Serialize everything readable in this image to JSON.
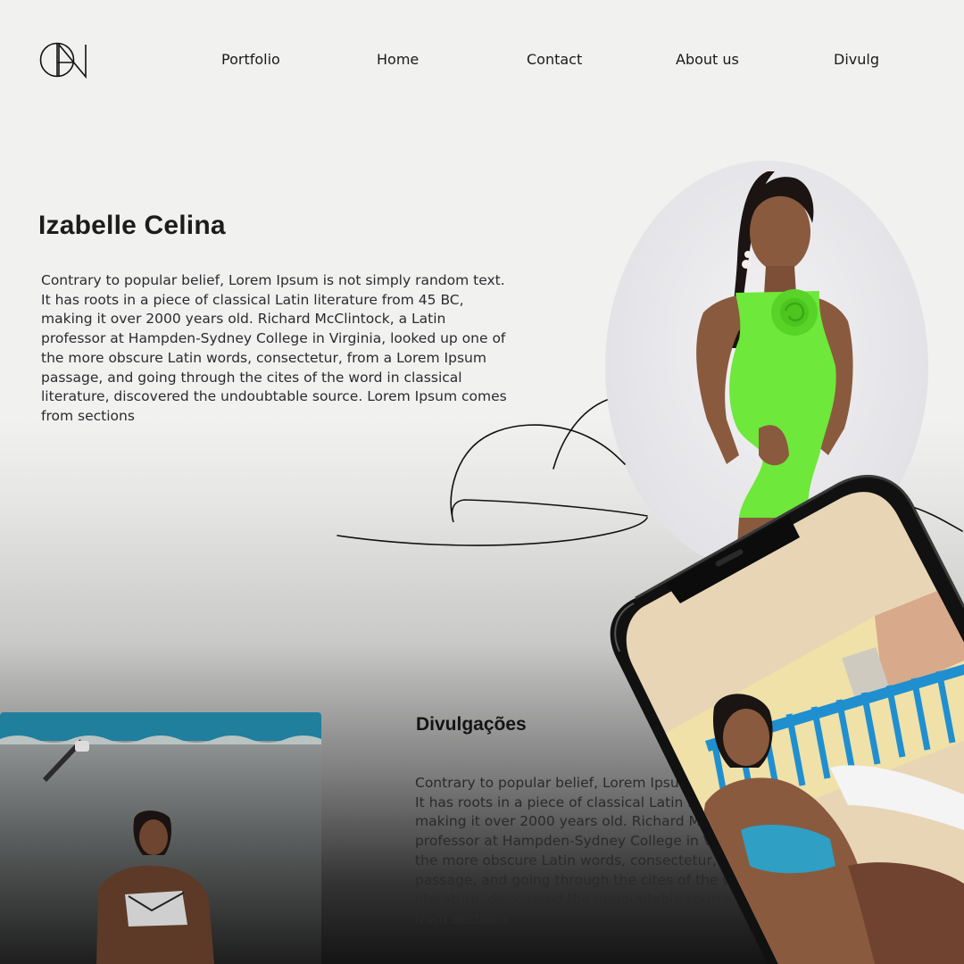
{
  "nav": {
    "items": [
      {
        "label": "Portfolio"
      },
      {
        "label": "Home"
      },
      {
        "label": "Contact"
      },
      {
        "label": "About us"
      },
      {
        "label": "Divulg"
      }
    ]
  },
  "hero": {
    "title": "Izabelle Celina",
    "text": "Contrary to popular belief, Lorem Ipsum is not simply random text. It has roots in a piece of classical Latin literature from 45 BC, making it over 2000 years old. Richard McClintock, a Latin professor at Hampden-Sydney College in Virginia, looked up one of the more obscure Latin words, consectetur, from a Lorem Ipsum passage, and going through the cites of the word in classical literature, discovered the undoubtable source. Lorem Ipsum comes from sections"
  },
  "section": {
    "title": "Divulgações",
    "text": "Contrary to popular belief, Lorem Ipsum is not simply random text. It has roots in a piece of classical Latin literature from 45 BC, making it over 2000 years old. Richard McClintock, a Latin professor at Hampden-Sydney College in Virginia, looked up one of the more obscure Latin words, consectetur, from a Lorem Ipsum passage, and going through the cites of the word in classical literature, discovered the undoubtable source. Lorem Ipsum comes from sections"
  },
  "colors": {
    "background": "#f1f1ef",
    "dress": "#6ee83a",
    "bikini": "#2f9fc4",
    "fence": "#1f8fd0"
  }
}
